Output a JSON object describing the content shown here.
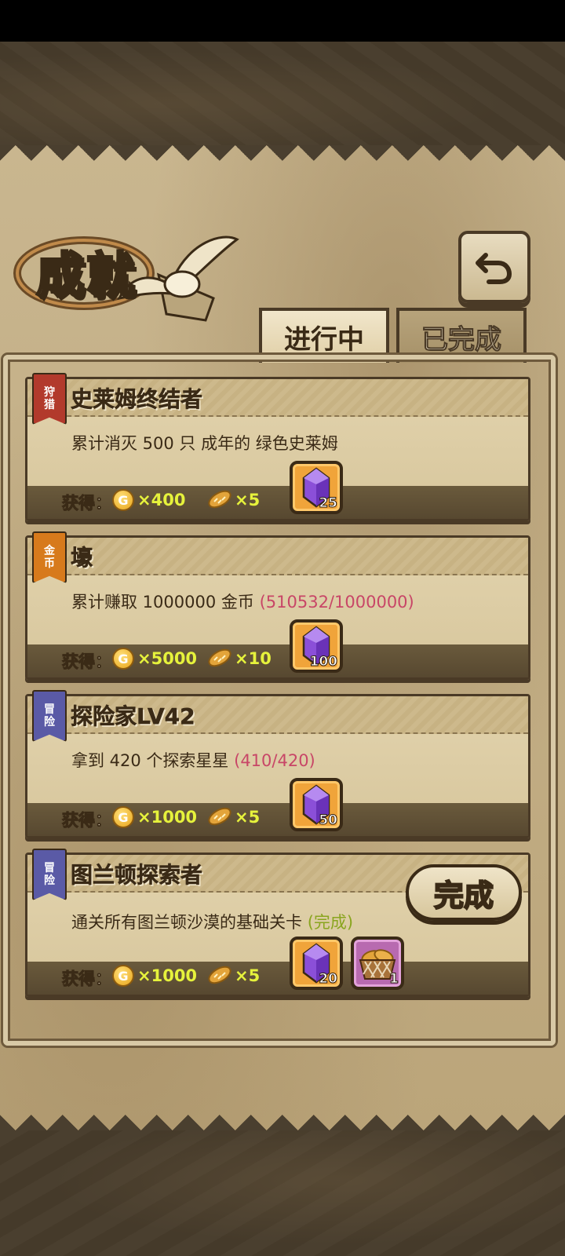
{
  "header": {
    "title": "成就",
    "tabs": [
      {
        "label": "进行中",
        "active": true
      },
      {
        "label": "已完成",
        "active": false
      }
    ]
  },
  "achievements": [
    {
      "badge": "狩猎",
      "badge_color": "#b23a2c",
      "title": "史莱姆终结者",
      "desc": "累计消灭 500 只 成年的 绿色史莱姆",
      "progress": "",
      "reward_label": "获得：",
      "coins": "×400",
      "bread": "×5",
      "gem_count": "25"
    },
    {
      "badge": "金币",
      "badge_color": "#d77a1c",
      "title": "壕",
      "desc": "累计赚取 1000000 金币",
      "progress": "(510532/1000000)",
      "reward_label": "获得：",
      "coins": "×5000",
      "bread": "×10",
      "gem_count": "100"
    },
    {
      "badge": "冒险",
      "badge_color": "#5a5aa6",
      "title": "探险家LV42",
      "desc": "拿到 420 个探索星星",
      "progress": "(410/420)",
      "reward_label": "获得：",
      "coins": "×1000",
      "bread": "×5",
      "gem_count": "50"
    },
    {
      "badge": "冒险",
      "badge_color": "#5a5aa6",
      "title": "图兰顿探索者",
      "desc": "通关所有图兰顿沙漠的基础关卡",
      "progress": "(完成)",
      "reward_label": "获得：",
      "coins": "×1000",
      "bread": "×5",
      "gem_count": "20",
      "extra_item_count": "1",
      "complete_button": "完成"
    }
  ],
  "icons": {
    "back": "back-arrow-icon",
    "coin_letter": "G",
    "gem": "purple-gem-icon",
    "bread": "bread-icon",
    "bread_basket": "bread-basket-icon"
  }
}
